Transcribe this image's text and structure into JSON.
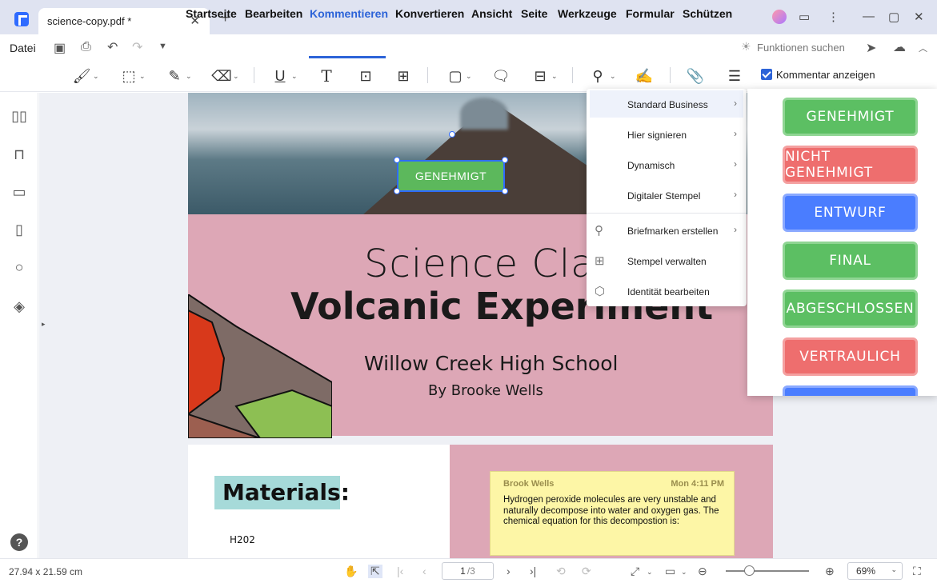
{
  "window": {
    "tab_title": "science-copy.pdf *",
    "tab_close": "✕",
    "tab_add": "+",
    "controls": [
      "—",
      "▢",
      "✕"
    ]
  },
  "menu": {
    "file": "Datei",
    "items": [
      "Startseite",
      "Bearbeiten",
      "Kommentieren",
      "Konvertieren",
      "Ansicht",
      "Seite",
      "Werkzeuge",
      "Formular",
      "Schützen"
    ],
    "active": "Kommentieren",
    "search_hint": "Funktionen suchen"
  },
  "toolbar": {
    "show_comments_label": "Kommentar anzeigen",
    "show_comments_checked": true
  },
  "document": {
    "cover": {
      "title_line1": "Science Class",
      "title_line2": "Volcanic Experiment",
      "school": "Willow Creek High School",
      "author": "By Brooke Wells"
    },
    "placed_stamp": "GENEHMIGT",
    "materials_heading": "Materials:",
    "sketch_label": "H202",
    "note": {
      "author": "Brook Wells",
      "time": "Mon 4:11 PM",
      "text": "Hydrogen peroxide molecules are very unstable and naturally decompose into water and oxygen gas. The chemical equation for this decompostion is:"
    }
  },
  "stamp_menu": {
    "items": [
      {
        "label": "Standard Business",
        "has_submenu": true,
        "hover": true
      },
      {
        "label": "Hier signieren",
        "has_submenu": true
      },
      {
        "label": "Dynamisch",
        "has_submenu": true
      },
      {
        "label": "Digitaler Stempel",
        "has_submenu": true
      },
      {
        "label": "Briefmarken erstellen",
        "has_submenu": true,
        "icon": "stamp-icon"
      },
      {
        "label": "Stempel verwalten",
        "has_submenu": false,
        "icon": "grid-icon"
      },
      {
        "label": "Identität bearbeiten",
        "has_submenu": false,
        "icon": "identity-icon"
      }
    ]
  },
  "stamps": [
    {
      "label": "GENEHMIGT",
      "color": "#5cbf63"
    },
    {
      "label": "NICHT GENEHMIGT",
      "color": "#ee6e6e"
    },
    {
      "label": "ENTWURF",
      "color": "#4a7dff"
    },
    {
      "label": "FINAL",
      "color": "#5cbf63"
    },
    {
      "label": "ABGESCHLOSSEN",
      "color": "#5cbf63"
    },
    {
      "label": "VERTRAULICH",
      "color": "#ee6e6e"
    },
    {
      "label": "",
      "color": "#4a7dff"
    }
  ],
  "status": {
    "dimensions": "27.94 x 21.59 cm",
    "page_current": "1",
    "page_total": "/3",
    "zoom": "69%",
    "zoom_fraction": 0.28
  },
  "colors": {
    "accent": "#2c63d8",
    "cover_pink": "#dda7b6",
    "materials_bg": "#a6dad9",
    "note_bg": "#fdf6a6"
  }
}
